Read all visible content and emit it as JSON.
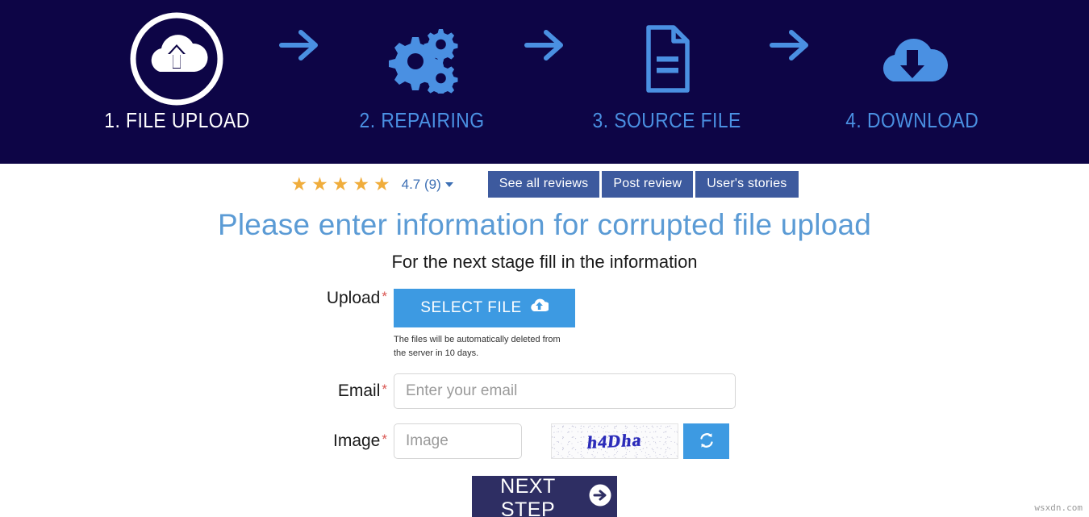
{
  "steps": {
    "items": [
      {
        "label": "1. FILE UPLOAD",
        "icon": "cloud-upload-circle-icon",
        "state": "active"
      },
      {
        "label": "2. REPAIRING",
        "icon": "gears-icon",
        "state": "inactive"
      },
      {
        "label": "3. SOURCE FILE",
        "icon": "document-icon",
        "state": "inactive"
      },
      {
        "label": "4. DOWNLOAD",
        "icon": "cloud-download-icon",
        "state": "inactive"
      }
    ],
    "separator_icon": "arrow-right-icon",
    "background_color": "#0d0546",
    "active_color": "#ffffff",
    "inactive_color": "#4a90e2"
  },
  "review": {
    "stars_filled": 5,
    "star_glyph": "★",
    "star_color": "#f0ad3c",
    "rating_text": "4.7 (9)",
    "rating_color": "#3c6fb4",
    "dropdown_icon": "caret-down-icon",
    "buttons": [
      {
        "label": "See all reviews",
        "name": "see-all-reviews-button"
      },
      {
        "label": "Post review",
        "name": "post-review-button"
      },
      {
        "label": "User's stories",
        "name": "users-stories-button"
      }
    ],
    "button_color": "#3d5a9e"
  },
  "page": {
    "title": "Please enter information for corrupted file upload",
    "title_color": "#5b9bd5",
    "subtitle": "For the next stage fill in the information"
  },
  "form": {
    "upload": {
      "label": "Upload",
      "required_marker": "*",
      "button_label": "SELECT FILE",
      "button_icon": "cloud-upload-icon",
      "button_color": "#3d9ae2",
      "note": "The files will be automatically deleted from the server in 10 days."
    },
    "email": {
      "label": "Email",
      "required_marker": "*",
      "placeholder": "Enter your email",
      "value": ""
    },
    "image": {
      "label": "Image",
      "required_marker": "*",
      "placeholder": "Image",
      "value": "",
      "captcha_text": "h4Dha",
      "refresh_icon": "refresh-icon",
      "refresh_button_color": "#3d9ae2"
    },
    "submit": {
      "label": "NEXT STEP",
      "icon": "arrow-right-circle-icon",
      "color": "#2e2e63"
    }
  },
  "watermark": {
    "text": "wsxdn.com"
  }
}
